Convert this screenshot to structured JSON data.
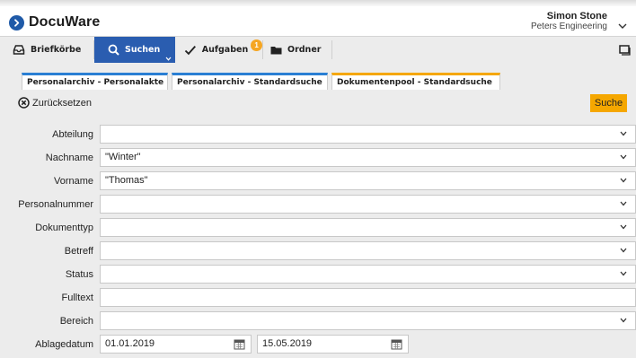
{
  "app": {
    "name": "DocuWare"
  },
  "user": {
    "name": "Simon Stone",
    "organization": "Peters Engineering"
  },
  "nav": {
    "items": [
      {
        "label": "Briefkörbe",
        "icon": "inbox-icon"
      },
      {
        "label": "Suchen",
        "icon": "search-icon"
      },
      {
        "label": "Aufgaben",
        "icon": "checkmark-icon",
        "badge": "1"
      },
      {
        "label": "Ordner",
        "icon": "folder-icon"
      }
    ]
  },
  "tabs": [
    {
      "label": "Personalarchiv - Personalakte",
      "color": "#2a7fd4"
    },
    {
      "label": "Personalarchiv - Standardsuche",
      "color": "#2a7fd4"
    },
    {
      "label": "Dokumentenpool - Standardsuche",
      "color": "#f5a700"
    }
  ],
  "toolbar": {
    "reset_label": "Zurücksetzen",
    "search_label": "Suche"
  },
  "form": {
    "fields": [
      {
        "label": "Abteilung",
        "value": ""
      },
      {
        "label": "Nachname",
        "value": "\"Winter\""
      },
      {
        "label": "Vorname",
        "value": "\"Thomas\""
      },
      {
        "label": "Personalnummer",
        "value": ""
      },
      {
        "label": "Dokumenttyp",
        "value": ""
      },
      {
        "label": "Betreff",
        "value": ""
      },
      {
        "label": "Status",
        "value": ""
      },
      {
        "label": "Fulltext",
        "value": ""
      },
      {
        "label": "Bereich",
        "value": ""
      }
    ],
    "date": {
      "label": "Ablagedatum",
      "from": "01.01.2019",
      "to": "15.05.2019"
    }
  },
  "colors": {
    "brand": "#1f5aa8",
    "nav_active": "#2a5db0",
    "accent": "#f5a700"
  }
}
